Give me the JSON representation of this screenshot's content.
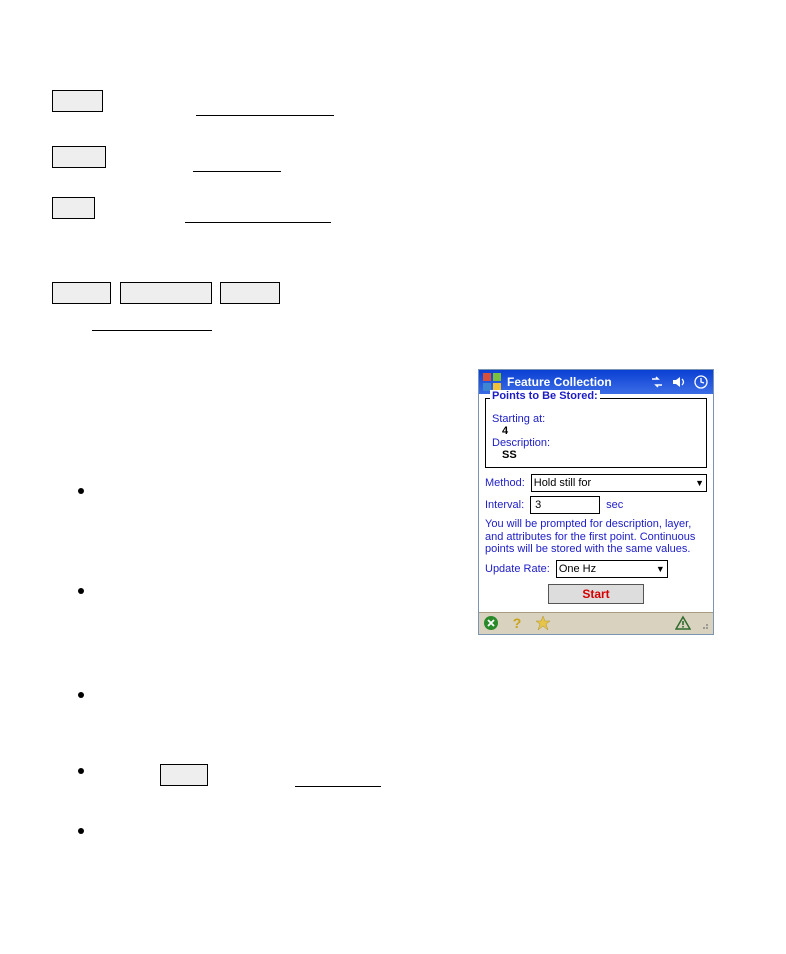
{
  "wm": {
    "title": "Feature Collection",
    "points_legend": "Points to Be Stored:",
    "starting_at_label": "Starting at:",
    "starting_at_value": "4",
    "description_label": "Description:",
    "description_value": "SS",
    "method_label": "Method:",
    "method_value": "Hold still for",
    "interval_label": "Interval:",
    "interval_value": "3",
    "interval_unit": "sec",
    "note": "You will be prompted for description, layer,  and attributes for the first point. Continuous points will be stored with the same values.",
    "update_rate_label": "Update Rate:",
    "update_rate_value": "One Hz",
    "start_label": "Start"
  }
}
